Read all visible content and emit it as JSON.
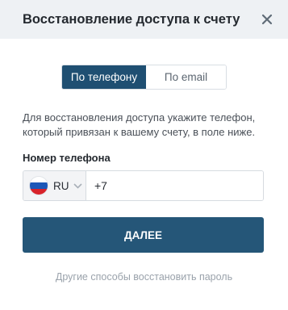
{
  "dialog": {
    "title": "Восстановление доступа к счету",
    "close_icon": "close-icon"
  },
  "tabs": [
    {
      "label": "По телефону",
      "active": true
    },
    {
      "label": "По email",
      "active": false
    }
  ],
  "hint": "Для восстановления доступа укажите телефон, который привязан к вашему счету, в поле ниже.",
  "phone": {
    "label": "Номер телефона",
    "country_code": "RU",
    "flag_icon": "russia-flag-icon",
    "value": "+7"
  },
  "submit_label": "ДАЛЕЕ",
  "other_methods_link": "Другие способы восстановить пароль",
  "colors": {
    "primary": "#255678",
    "header_bg": "#eef1f4",
    "link": "#9aa2ab"
  }
}
